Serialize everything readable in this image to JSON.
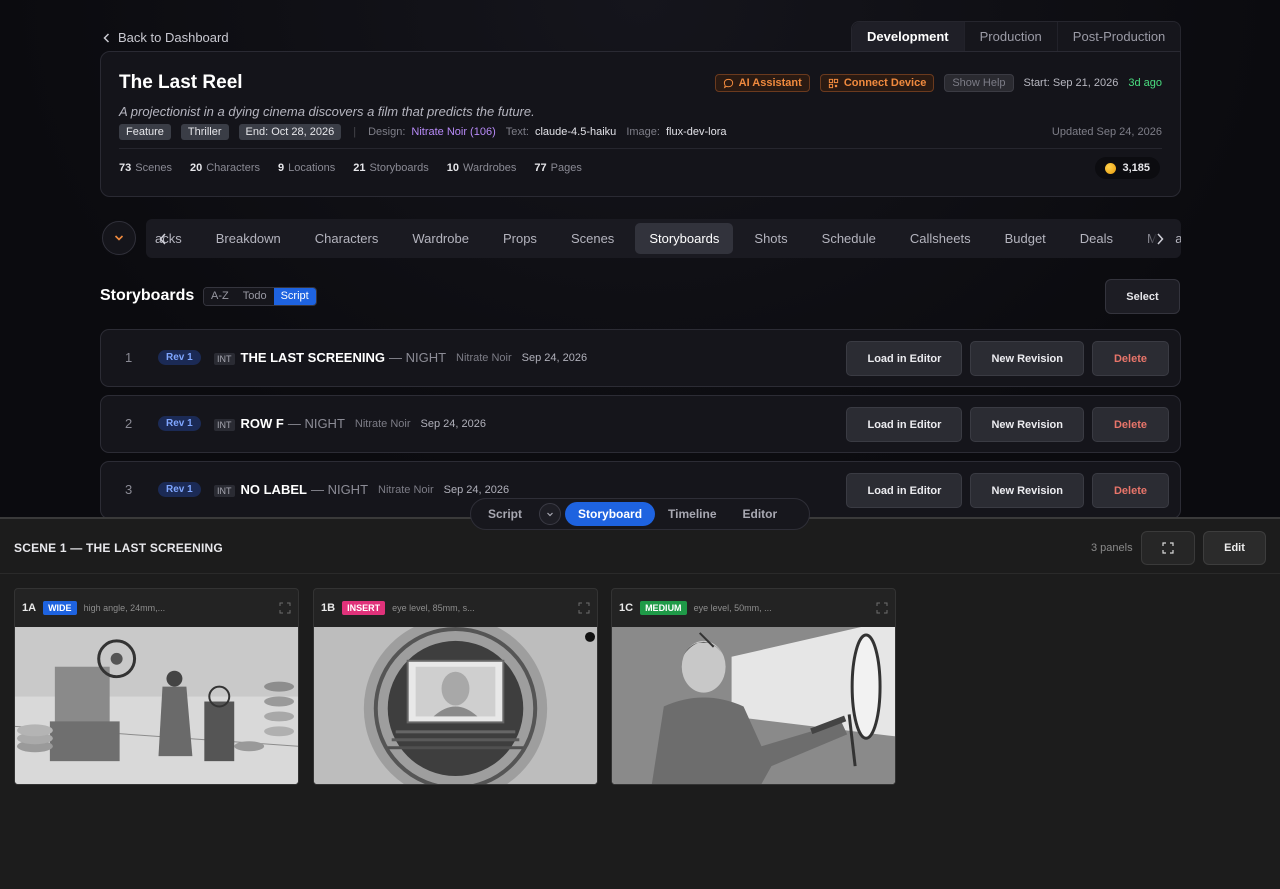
{
  "nav": {
    "back_label": "Back to Dashboard",
    "phase_tabs": [
      "Development",
      "Production",
      "Post-Production"
    ],
    "sections": [
      "acks",
      "Breakdown",
      "Characters",
      "Wardrobe",
      "Props",
      "Scenes",
      "Storyboards",
      "Shots",
      "Schedule",
      "Callsheets",
      "Budget",
      "Deals",
      "Media"
    ]
  },
  "project": {
    "title": "The Last Reel",
    "logline": "A projectionist in a dying cinema discovers a film that predicts the future.",
    "ai_assistant": "AI Assistant",
    "connect_device": "Connect Device",
    "show_help": "Show Help",
    "start": "Start: Sep 21, 2026",
    "ago": "3d ago",
    "tags": [
      "Feature",
      "Thriller",
      "End: Oct 28, 2026"
    ],
    "design_label": "Design:",
    "design_value": "Nitrate Noir (106)",
    "text_label": "Text:",
    "text_value": "claude-4.5-haiku",
    "image_label": "Image:",
    "image_value": "flux-dev-lora",
    "updated": "Updated Sep 24, 2026",
    "stats": [
      {
        "num": "73",
        "label": "Scenes"
      },
      {
        "num": "20",
        "label": "Characters"
      },
      {
        "num": "9",
        "label": "Locations"
      },
      {
        "num": "21",
        "label": "Storyboards"
      },
      {
        "num": "10",
        "label": "Wardrobes"
      },
      {
        "num": "77",
        "label": "Pages"
      }
    ],
    "credits": "3,185"
  },
  "storyboards": {
    "title": "Storyboards",
    "sort_options": [
      "A-Z",
      "Todo",
      "Script"
    ],
    "select_label": "Select",
    "rows": [
      {
        "num": "1",
        "rev": "Rev 1",
        "int": "INT",
        "name": "THE LAST SCREENING",
        "time": "— NIGHT",
        "style": "Nitrate Noir",
        "date": "Sep 24, 2026"
      },
      {
        "num": "2",
        "rev": "Rev 1",
        "int": "INT",
        "name": "ROW F",
        "time": "— NIGHT",
        "style": "Nitrate Noir",
        "date": "Sep 24, 2026"
      },
      {
        "num": "3",
        "rev": "Rev 1",
        "int": "INT",
        "name": "NO LABEL",
        "time": "— NIGHT",
        "style": "Nitrate Noir",
        "date": "Sep 24, 2026"
      }
    ],
    "actions": {
      "load": "Load in Editor",
      "revision": "New Revision",
      "delete": "Delete"
    }
  },
  "view_switcher": [
    "Script",
    "Storyboard",
    "Timeline",
    "Editor"
  ],
  "scene_panel": {
    "title": "SCENE 1 — THE LAST SCREENING",
    "panel_count": "3 panels",
    "edit_label": "Edit",
    "panels": [
      {
        "id": "1A",
        "shot": "WIDE",
        "shot_color": "#1e63e0",
        "desc": "high angle, 24mm,..."
      },
      {
        "id": "1B",
        "shot": "INSERT",
        "shot_color": "#e0327a",
        "desc": "eye level, 85mm, s..."
      },
      {
        "id": "1C",
        "shot": "MEDIUM",
        "shot_color": "#1f9a48",
        "desc": "eye level, 50mm, ..."
      }
    ]
  },
  "colors": {
    "accent": "#1e63e0",
    "orange": "#f08a3e",
    "green": "#4ade80",
    "danger": "#e8756a",
    "purple": "#b78af7"
  }
}
